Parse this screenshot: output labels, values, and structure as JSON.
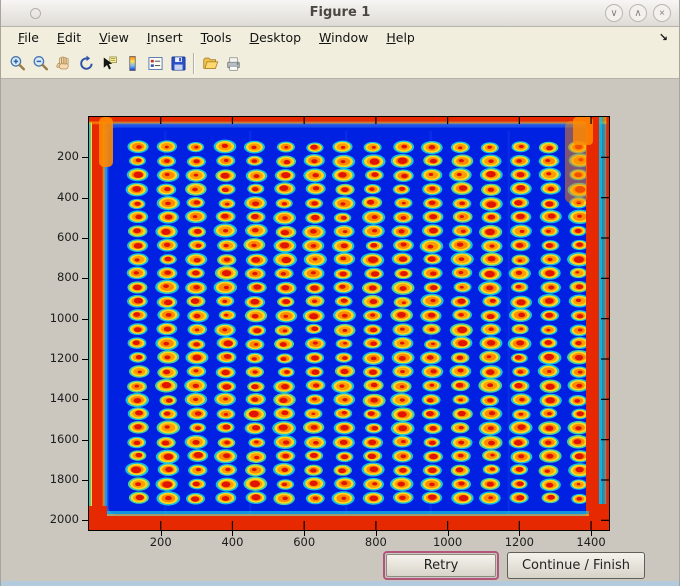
{
  "window": {
    "title": "Figure 1",
    "controls": {
      "minimize": "∨",
      "maximize": "∧",
      "close": "×"
    }
  },
  "menu": {
    "items": [
      "File",
      "Edit",
      "View",
      "Insert",
      "Tools",
      "Desktop",
      "Window",
      "Help"
    ],
    "dock_arrow": "↘"
  },
  "toolbar": {
    "buttons": [
      "zoom-in",
      "zoom-out",
      "pan",
      "rotate-3d",
      "data-cursor",
      "insert-colorbar",
      "insert-legend",
      "save-figure",
      "separator",
      "open-file",
      "print-figure"
    ]
  },
  "plot": {
    "type": "image",
    "description": "microplate well image, jet colormap",
    "x_ticks": [
      200,
      400,
      600,
      800,
      1000,
      1200,
      1400
    ],
    "y_ticks": [
      200,
      400,
      600,
      800,
      1000,
      1200,
      1400,
      1600,
      1800,
      2000
    ],
    "x_max": 1450,
    "y_max": 2048,
    "grid": {
      "rows": 26,
      "cols": 16
    },
    "colors": {
      "background": "#0020e2",
      "inner_frame": "#1e57f0",
      "halo": "#1bd0da",
      "halo_alt": "#49df9e",
      "ring": "#ffd81e",
      "mid": "#ff8a00",
      "mid_alt": "#ff9c00",
      "center": "#e01400",
      "edge_red": "#e62900",
      "edge_orange": "#ff8a00",
      "edge_yellow": "#ffd81e",
      "edge_cyan": "#19c8e0"
    }
  },
  "buttons": {
    "retry": "Retry",
    "continue_finish": "Continue / Finish"
  }
}
